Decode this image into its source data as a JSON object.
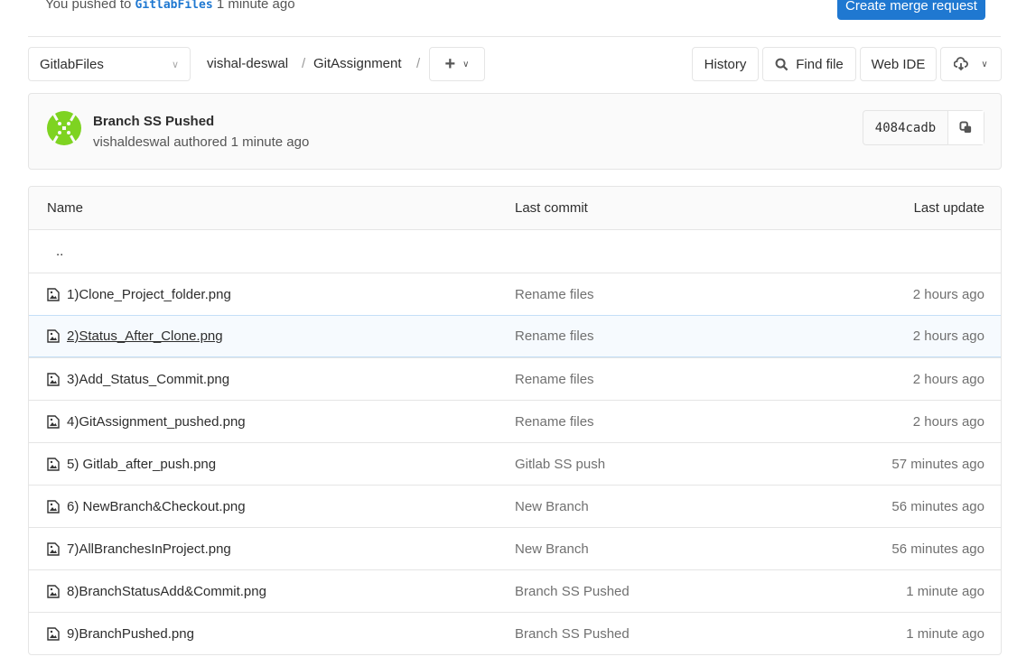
{
  "flash": {
    "prefix": "You pushed to",
    "branch": "GitlabFiles",
    "suffix": "1 minute ago"
  },
  "create_mr": "Create merge request",
  "branch_select": "GitlabFiles",
  "breadcrumb": [
    "vishal-deswal",
    "GitAssignment"
  ],
  "separator": "/",
  "toolbar": {
    "history": "History",
    "find_file": "Find file",
    "web_ide": "Web IDE"
  },
  "commit": {
    "title": "Branch SS Pushed",
    "author": "vishaldeswal",
    "authored": "authored",
    "time": "1 minute ago",
    "sha": "4084cadb"
  },
  "table": {
    "headers": [
      "Name",
      "Last commit",
      "Last update"
    ],
    "parent": "..",
    "rows": [
      {
        "name": "1)Clone_Project_folder.png",
        "commit": "Rename files",
        "updated": "2 hours ago"
      },
      {
        "name": "2)Status_After_Clone.png",
        "commit": "Rename files",
        "updated": "2 hours ago"
      },
      {
        "name": "3)Add_Status_Commit.png",
        "commit": "Rename files",
        "updated": "2 hours ago"
      },
      {
        "name": "4)GitAssignment_pushed.png",
        "commit": "Rename files",
        "updated": "2 hours ago"
      },
      {
        "name": "5) Gitlab_after_push.png",
        "commit": "Gitlab SS push",
        "updated": "57 minutes ago"
      },
      {
        "name": "6) NewBranch&Checkout.png",
        "commit": "New Branch",
        "updated": "56 minutes ago"
      },
      {
        "name": "7)AllBranchesInProject.png",
        "commit": "New Branch",
        "updated": "56 minutes ago"
      },
      {
        "name": "8)BranchStatusAdd&Commit.png",
        "commit": "Branch SS Pushed",
        "updated": "1 minute ago"
      },
      {
        "name": "9)BranchPushed.png",
        "commit": "Branch SS Pushed",
        "updated": "1 minute ago"
      }
    ]
  }
}
